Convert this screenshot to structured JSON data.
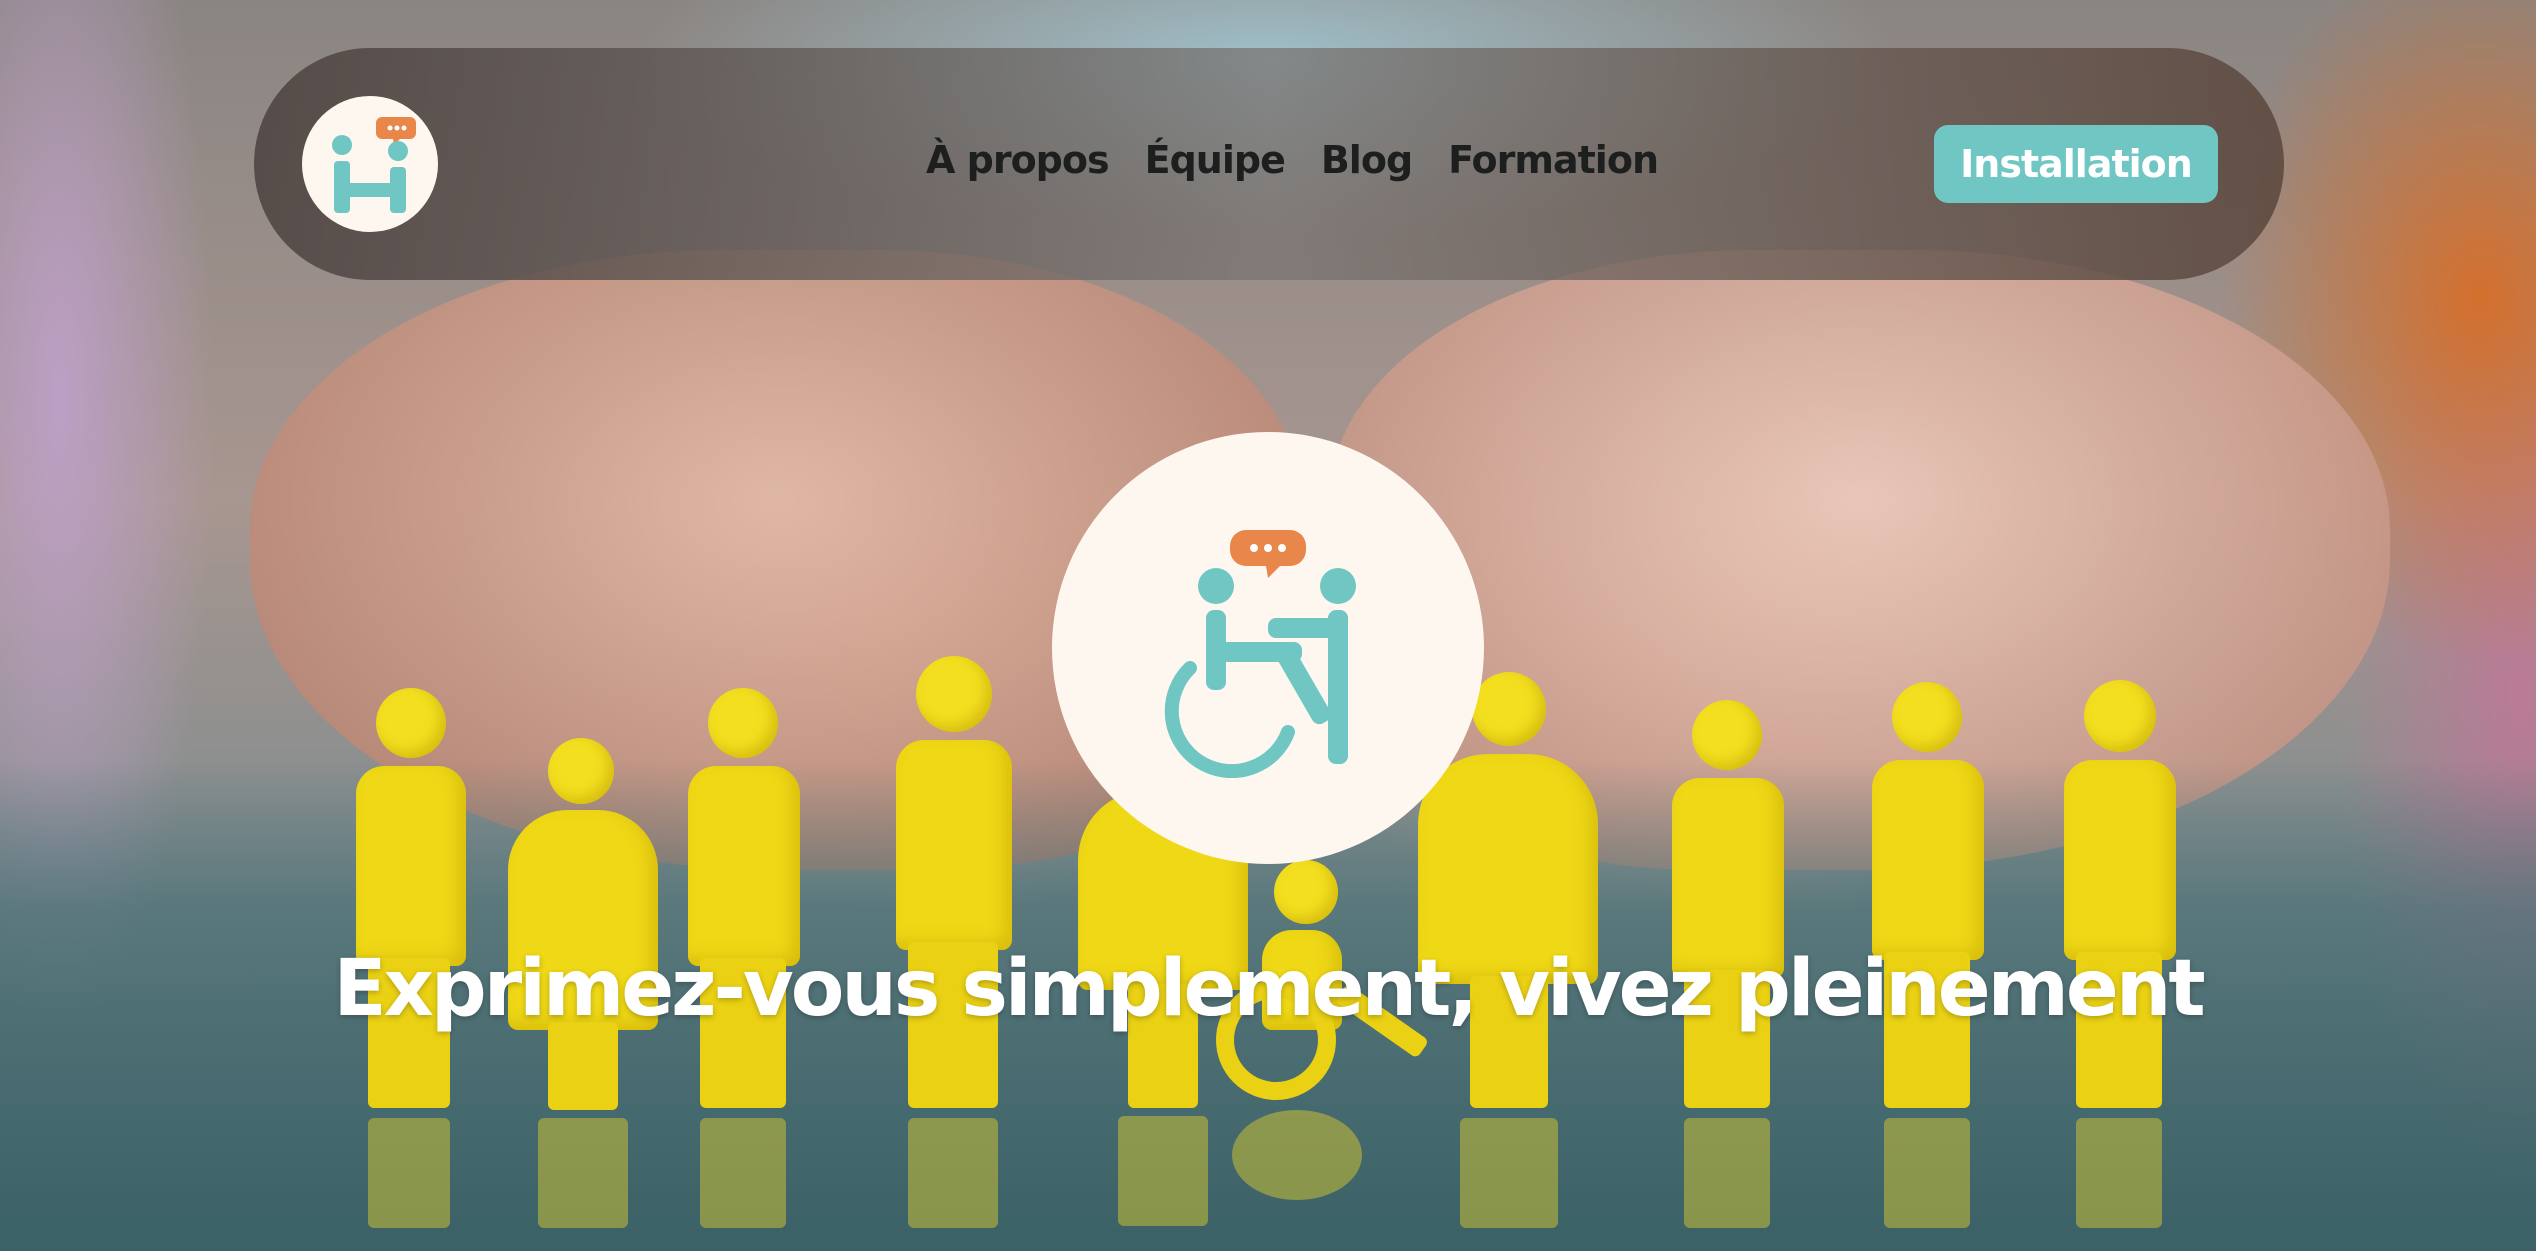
{
  "nav": {
    "links": [
      {
        "label": "À propos"
      },
      {
        "label": "Équipe"
      },
      {
        "label": "Blog"
      },
      {
        "label": "Formation"
      }
    ],
    "cta_label": "Installation"
  },
  "hero": {
    "headline": "Exprimez-vous simplement, vivez pleinement"
  },
  "colors": {
    "accent_teal": "#6fc6c2",
    "accent_orange": "#e9864a",
    "logo_bg": "#fdf7f0",
    "nav_text": "#1d1f1f",
    "headline_text": "#ffffff"
  },
  "icons": {
    "logo": "hi-logo-icon",
    "emblem": "wheelchair-conversation-icon",
    "speech": "speech-bubble-icon"
  }
}
